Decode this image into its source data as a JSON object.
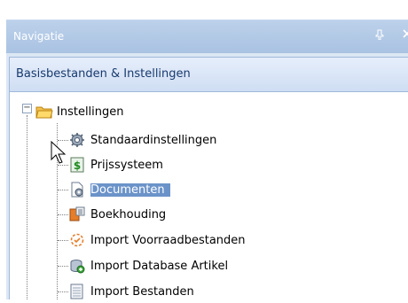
{
  "panel": {
    "title": "Navigatie",
    "pin_glyph": "↕",
    "close_glyph": "×"
  },
  "group": {
    "title": "Basisbestanden & Instellingen"
  },
  "tree": {
    "root": {
      "label": "Instellingen",
      "icon": "folder-icon",
      "expanded": true
    },
    "items": [
      {
        "label": "Standaardinstellingen",
        "icon": "settings-gear-icon"
      },
      {
        "label": "Prijssysteem",
        "icon": "dollar-icon"
      },
      {
        "label": "Documenten",
        "icon": "document-gear-icon",
        "selected": true
      },
      {
        "label": "Boekhouding",
        "icon": "ledger-icon"
      },
      {
        "label": "Import Voorraadbestanden",
        "icon": "import-stock-icon"
      },
      {
        "label": "Import Database Artikel",
        "icon": "import-database-icon"
      },
      {
        "label": "Import Bestanden",
        "icon": "import-files-icon"
      }
    ]
  }
}
